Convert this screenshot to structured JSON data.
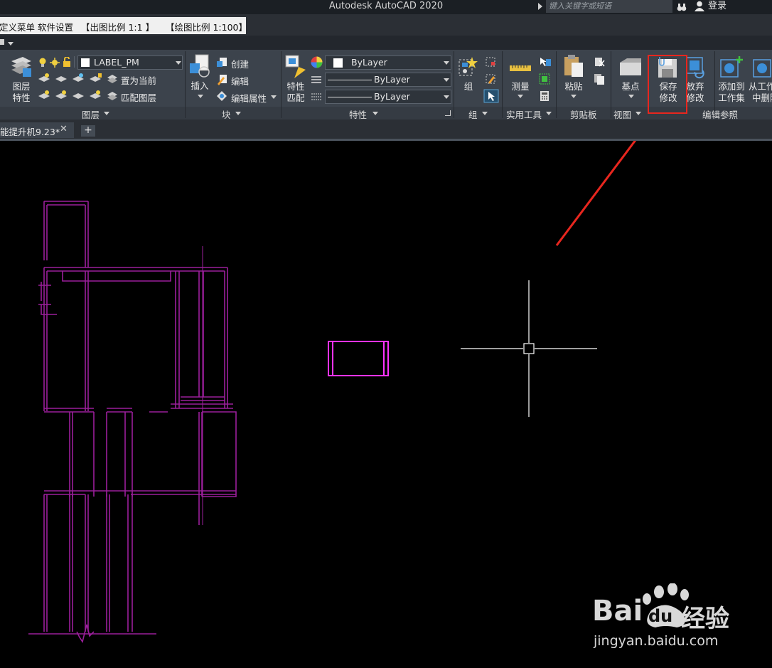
{
  "window": {
    "title": "Autodesk AutoCAD 2020",
    "search_placeholder": "键入关键字或短语",
    "login": "登录"
  },
  "menu": {
    "items": [
      "定义菜单",
      "软件设置",
      "【出图比例 1:1 】",
      "【绘图比例 1:100】"
    ]
  },
  "ribbon": {
    "layer": {
      "big_label_1": "图层",
      "big_label_2": "特性",
      "layer_name": "LABEL_PM",
      "set_current": "置为当前",
      "match_layer": "匹配图层",
      "group": "图层"
    },
    "block": {
      "insert": "插入",
      "create": "创建",
      "edit": "编辑",
      "edit_attrib": "编辑属性",
      "group": "块"
    },
    "properties": {
      "match_1": "特性",
      "match_2": "匹配",
      "color": "ByLayer",
      "linetype": "ByLayer",
      "lineweight": "ByLayer",
      "group": "特性"
    },
    "groups": {
      "group": "组",
      "group_label": "组"
    },
    "utilities": {
      "measure": "测量",
      "group": "实用工具"
    },
    "clipboard": {
      "paste": "粘贴",
      "group": "剪贴板"
    },
    "view": {
      "base": "基点",
      "group": "视图"
    },
    "refedit": {
      "save_1": "保存",
      "save_2": "修改",
      "discard_1": "放弃",
      "discard_2": "修改",
      "add_1": "添加到",
      "add_2": "工作集",
      "remove_1": "从工作",
      "remove_2": "中删除",
      "group": "编辑参照"
    }
  },
  "tabs": {
    "doc_name": "能提升机9.23*",
    "close": "✕",
    "add": "+"
  },
  "colors": {
    "highlight": "#e8261e",
    "drawing": "#a020a0",
    "selected": "#ff33ff"
  },
  "watermark": {
    "brand_latin": "Bai",
    "brand_latin_2": "du",
    "brand_cn": "经验",
    "url": "jingyan.baidu.com"
  }
}
